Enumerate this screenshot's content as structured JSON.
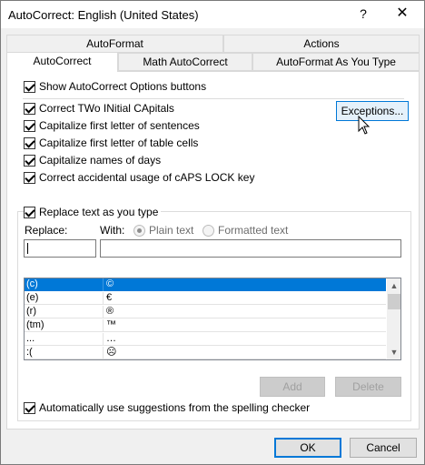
{
  "window": {
    "title": "AutoCorrect: English (United States)"
  },
  "titlebar": {
    "help_glyph": "?",
    "close_glyph": "✕"
  },
  "tabs": [
    {
      "label": "AutoFormat"
    },
    {
      "label": "Actions"
    },
    {
      "label": "AutoCorrect"
    },
    {
      "label": "Math AutoCorrect"
    },
    {
      "label": "AutoFormat As You Type"
    }
  ],
  "options": {
    "show_buttons": "Show AutoCorrect Options buttons",
    "two_initials": "Correct TWo INitial CApitals",
    "cap_sentences": "Capitalize first letter of sentences",
    "cap_cells": "Capitalize first letter of table cells",
    "cap_days": "Capitalize names of days",
    "caps_lock": "Correct accidental usage of cAPS LOCK key",
    "replace_as_type": "Replace text as you type",
    "spelling_suggestions": "Automatically use suggestions from the spelling checker"
  },
  "buttons": {
    "exceptions": "Exceptions...",
    "add": "Add",
    "delete": "Delete",
    "ok": "OK",
    "cancel": "Cancel"
  },
  "replace": {
    "replace_label": "Replace:",
    "with_label": "With:",
    "plain_text": "Plain text",
    "formatted_text": "Formatted text",
    "replace_value": "",
    "with_value": ""
  },
  "entries": [
    {
      "replace": "(c)",
      "with": "©"
    },
    {
      "replace": "(e)",
      "with": "€"
    },
    {
      "replace": "(r)",
      "with": "®"
    },
    {
      "replace": "(tm)",
      "with": "™"
    },
    {
      "replace": "...",
      "with": "…"
    },
    {
      "replace": ":(",
      "with": "☹"
    }
  ]
}
